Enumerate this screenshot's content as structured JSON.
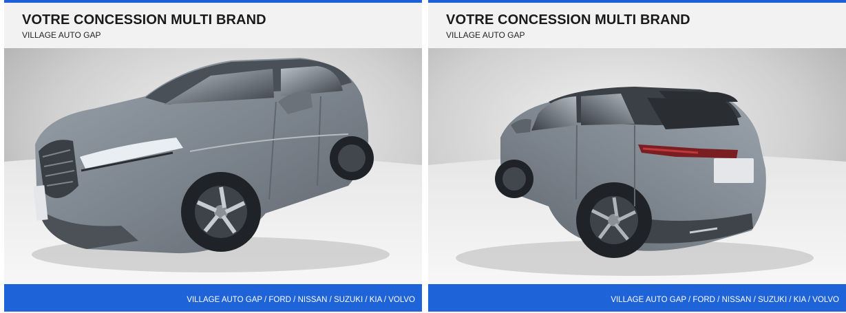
{
  "cards": [
    {
      "title": "VOTRE CONCESSION MULTI BRAND",
      "subtitle": "VILLAGE AUTO GAP",
      "photo": "car-front-three-quarter-photo",
      "footer": "VILLAGE AUTO GAP / FORD / NISSAN / SUZUKI / KIA / VOLVO"
    },
    {
      "title": "VOTRE CONCESSION MULTI BRAND",
      "subtitle": "VILLAGE AUTO GAP",
      "photo": "car-rear-three-quarter-photo",
      "footer": "VILLAGE AUTO GAP / FORD / NISSAN / SUZUKI / KIA / VOLVO"
    }
  ],
  "colors": {
    "accent_blue": "#1f63d9",
    "car_body": "#7d858e",
    "studio_floor": "#dcdcdc"
  }
}
